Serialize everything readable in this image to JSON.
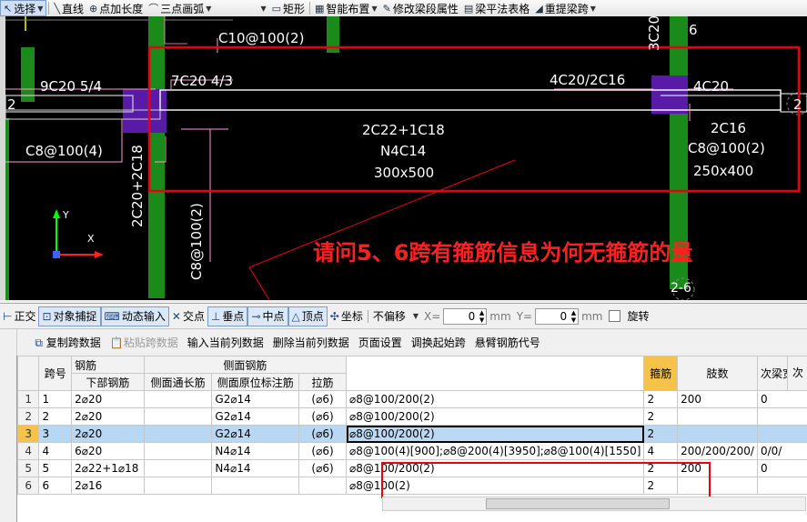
{
  "toolbar": {
    "select": "选择",
    "line": "直线",
    "point_length": "点加长度",
    "arc": "三点画弧",
    "rect": "矩形",
    "smart_layout": "智能布置",
    "modify_segment": "修改梁段属性",
    "beam_table": "梁平法表格",
    "re_extract": "重提梁跨"
  },
  "canvas": {
    "labels": {
      "c10": "C10@100(2)",
      "nine_c20": "9C20 5/4",
      "seven_c20": "7C20 4/3",
      "four_c20_2c16": "4C20/2C16",
      "three_c20": "3C20",
      "four_c20": "4C20",
      "six": "6",
      "two": "2",
      "two_right": "2",
      "two_c22": "2C22+1C18",
      "n4c14": "N4C14",
      "size_300": "300x500",
      "two_c16": "2C16",
      "c8_100_2": "C8@100(2)",
      "size_250": "250x400",
      "c8_100_4": "C8@100(4)",
      "two_c20_vert": "2C20+2C18",
      "c8_100_2_vert": "C8@100(2)",
      "two_dash_six": "2-6",
      "axis_y": "Y",
      "axis_x": "X"
    },
    "annotation": "请问5、6跨有箍筋信息为何无箍筋的量"
  },
  "snapbar": {
    "ortho": "正交",
    "object_snap": "对象捕捉",
    "dynamic_input": "动态输入",
    "intersection": "交点",
    "perpendicular": "垂点",
    "midpoint": "中点",
    "vertex": "顶点",
    "coord": "坐标",
    "offset_mode": "不偏移",
    "x_label": "X=",
    "x_value": "0",
    "mm1": "mm",
    "y_label": "Y=",
    "y_value": "0",
    "mm2": "mm",
    "rotate": "旋转"
  },
  "tabletoolbar": {
    "copy": "复制跨数据",
    "paste": "粘贴跨数据",
    "input_col": "输入当前列数据",
    "delete_col": "删除当前列数据",
    "page_setup": "页面设置",
    "swap_start": "调换起始跨",
    "cantilever": "悬臂钢筋代号"
  },
  "grid": {
    "headers": {
      "span": "跨号",
      "rebar": "钢筋",
      "bottom_rebar": "下部钢筋",
      "side_rebar": "侧面钢筋",
      "side_through": "侧面通长筋",
      "side_original": "侧面原位标注筋",
      "tie": "拉筋",
      "stirrup": "箍筋",
      "legs": "肢数",
      "sec_width": "次梁宽度",
      "next": "次"
    },
    "rows": [
      {
        "n": "1",
        "span": "1",
        "bottom": "2⌀20",
        "through": "",
        "original": "G2⌀14",
        "tie": "(⌀6)",
        "stirrup": "⌀8@100/200(2)",
        "legs": "2",
        "sec": "200",
        "next": "0"
      },
      {
        "n": "2",
        "span": "2",
        "bottom": "2⌀20",
        "through": "",
        "original": "G2⌀14",
        "tie": "(⌀6)",
        "stirrup": "⌀8@100/200(2)",
        "legs": "2",
        "sec": "",
        "next": ""
      },
      {
        "n": "3",
        "span": "3",
        "bottom": "2⌀20",
        "through": "",
        "original": "G2⌀14",
        "tie": "(⌀6)",
        "stirrup": "⌀8@100/200(2)",
        "legs": "2",
        "sec": "",
        "next": ""
      },
      {
        "n": "4",
        "span": "4",
        "bottom": "6⌀20",
        "through": "",
        "original": "N4⌀14",
        "tie": "(⌀6)",
        "stirrup": "⌀8@100(4)[900];⌀8@200(4)[3950];⌀8@100(4)[1550]",
        "legs": "4",
        "sec": "200/200/200/",
        "next": "0/0/"
      },
      {
        "n": "5",
        "span": "5",
        "bottom": "2⌀22+1⌀18",
        "through": "",
        "original": "N4⌀14",
        "tie": "(⌀6)",
        "stirrup": "⌀8@100/200(2)",
        "legs": "2",
        "sec": "200",
        "next": "0"
      },
      {
        "n": "6",
        "span": "6",
        "bottom": "2⌀16",
        "through": "",
        "original": "",
        "tie": "",
        "stirrup": "⌀8@100(2)",
        "legs": "2",
        "sec": "",
        "next": ""
      }
    ]
  },
  "colors": {
    "highlight": "#e8000f",
    "column_green": "#1a8a1a",
    "support_purple": "#5a1aa8",
    "header_gold": "#f5c34a"
  }
}
